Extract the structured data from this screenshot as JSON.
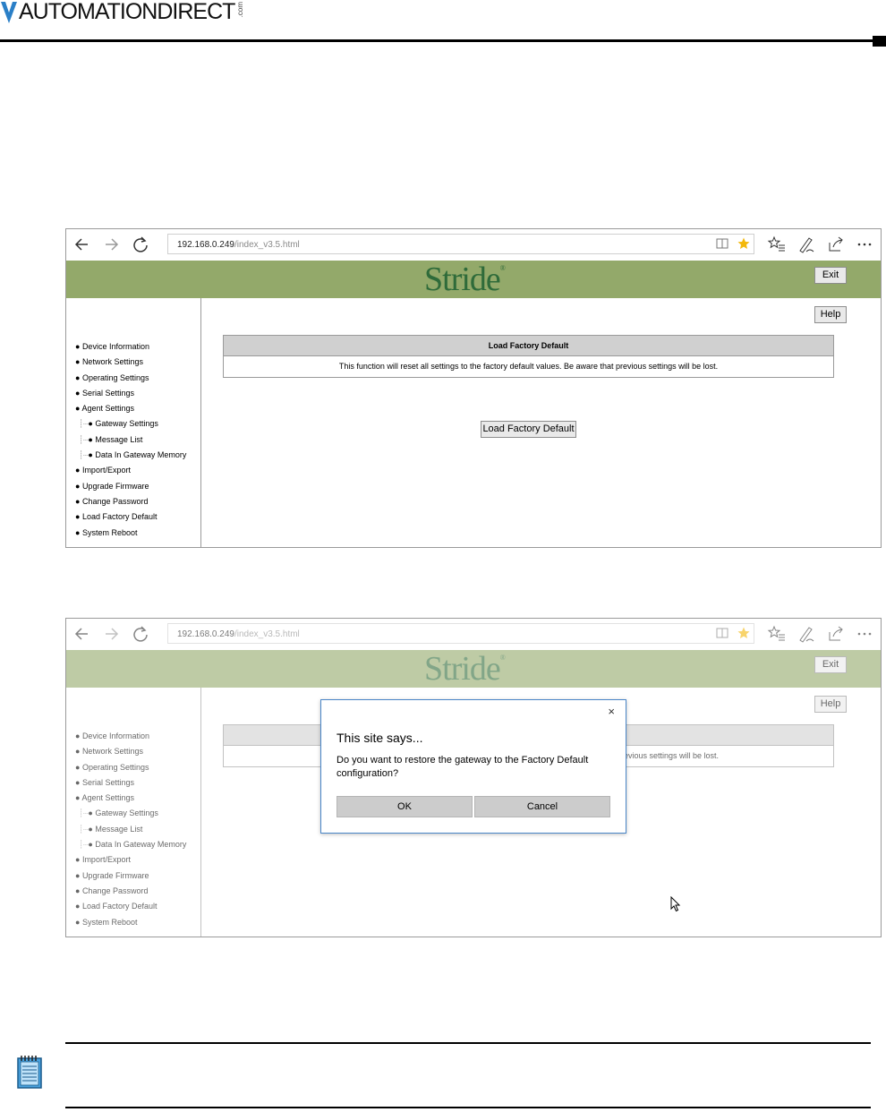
{
  "document": {
    "brand_name": "AUTOMATIONDIRECT",
    "brand_suffix": ".com"
  },
  "browser": {
    "url_host": "192.168.0.249",
    "url_path": "/index_v3.5.html"
  },
  "app": {
    "logo": "Stride",
    "logo_mark": "®",
    "exit_label": "Exit",
    "help_label": "Help",
    "nav": [
      {
        "label": "Device Information",
        "level": 0
      },
      {
        "label": "Network Settings",
        "level": 0
      },
      {
        "label": "Operating Settings",
        "level": 0
      },
      {
        "label": "Serial Settings",
        "level": 0
      },
      {
        "label": "Agent Settings",
        "level": 0
      },
      {
        "label": "Gateway Settings",
        "level": 1
      },
      {
        "label": "Message List",
        "level": 1
      },
      {
        "label": "Data In Gateway Memory",
        "level": 1
      },
      {
        "label": "Import/Export",
        "level": 0
      },
      {
        "label": "Upgrade Firmware",
        "level": 0
      },
      {
        "label": "Change Password",
        "level": 0
      },
      {
        "label": "Load Factory Default",
        "level": 0
      },
      {
        "label": "System Reboot",
        "level": 0
      }
    ],
    "panel_title": "Load Factory Default",
    "panel_text": "This function will reset all settings to the factory default values. Be aware that previous settings will be lost.",
    "panel_text_partial": "evious settings will be lost.",
    "action_button": "Load Factory Default"
  },
  "dialog": {
    "close": "×",
    "title": "This site says...",
    "message": "Do you want to restore the gateway to the Factory Default configuration?",
    "ok": "OK",
    "cancel": "Cancel"
  },
  "colors": {
    "banner": "#93a96a",
    "logo": "#2f6b3a",
    "dialog_border": "#4a86c8",
    "note_icon": "#4aa3df"
  }
}
